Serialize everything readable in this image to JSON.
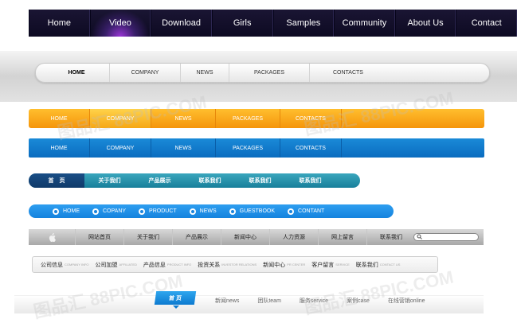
{
  "nav1": {
    "items": [
      "Home",
      "Video",
      "Download",
      "Girls",
      "Samples",
      "Community",
      "About Us",
      "Contact"
    ],
    "active": 1
  },
  "nav2": {
    "items": [
      "HOME",
      "COMPANY",
      "NEWS",
      "PACKAGES",
      "CONTACTS"
    ],
    "active": 0
  },
  "nav3": {
    "items": [
      "HOME",
      "COMPANY",
      "NEWS",
      "PACKAGES",
      "CONTACTS"
    ],
    "active": 1
  },
  "nav4": {
    "items": [
      "HOME",
      "COMPANY",
      "NEWS",
      "PACKAGES",
      "CONTACTS"
    ]
  },
  "nav5": {
    "home": "首　页",
    "items": [
      "关于我们",
      "产品展示",
      "联系我们",
      "联系我们",
      "联系我们"
    ]
  },
  "nav6": {
    "items": [
      "HOME",
      "COPANY",
      "PRODUCT",
      "NEWS",
      "GUESTBOOK",
      "CONTANT"
    ]
  },
  "nav7": {
    "apple_icon": "apple-icon",
    "items": [
      "网站首页",
      "关于我们",
      "产品展示",
      "新闻中心",
      "人力资源",
      "网上留言",
      "联系我们"
    ],
    "search_icon": "search-icon"
  },
  "nav8": {
    "items": [
      {
        "cn": "公司信息",
        "en": "COMPANY INFO"
      },
      {
        "cn": "公司加盟",
        "en": "AFFILIATED"
      },
      {
        "cn": "产品信息",
        "en": "PRODUCT INFO"
      },
      {
        "cn": "投资关系",
        "en": "INVESTOR RELATIONS"
      },
      {
        "cn": "新闻中心",
        "en": "PR CENTER"
      },
      {
        "cn": "客户留言",
        "en": "SERVICE"
      },
      {
        "cn": "联系我们",
        "en": "CONTACT US"
      }
    ]
  },
  "nav9": {
    "home": "首 页",
    "items": [
      "新闻news",
      "团队team",
      "服务service",
      "案例case",
      "在线营销online"
    ]
  },
  "watermark": "图品汇 88PIC.COM",
  "colors": {
    "nav1_bg": "#120e2b",
    "nav3_bg": "#f7a21a",
    "nav4_bg": "#117bd0",
    "nav5_bg": "#2590ab",
    "nav6_bg": "#1f90e7"
  }
}
